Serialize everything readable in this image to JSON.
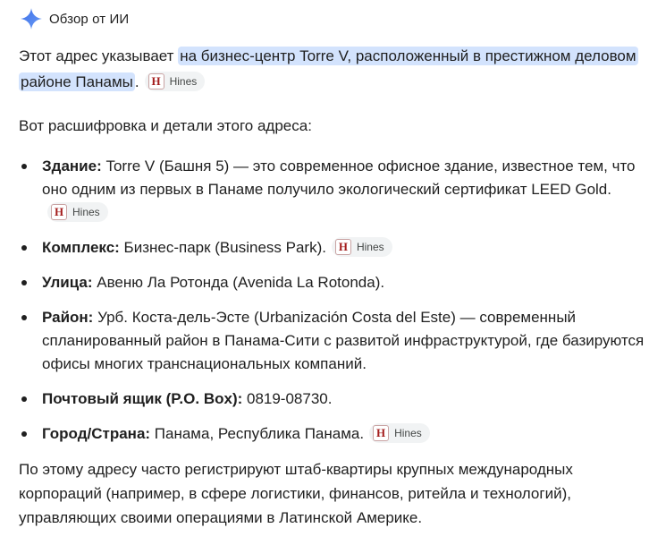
{
  "header": {
    "title": "Обзор от ИИ",
    "icon": "gemini-sparkle-icon",
    "icon_color": "#4a7bf0"
  },
  "intro": {
    "text_before": "Этот адрес указывает ",
    "highlight": "на бизнес-центр Torre V, расположенный в престижном деловом районе Панамы",
    "text_after": ".",
    "highlight_color": "#d3e3fd"
  },
  "source_label": "Hines",
  "subheading": "Вот расшифровка и детали этого адреса:",
  "details": [
    {
      "term": "Здание:",
      "text": " Torre V (Башня 5) — это современное офисное здание, известное тем, что оно одним из первых в Панаме получило экологический сертификат LEED Gold.",
      "source": "Hines"
    },
    {
      "term": "Комплекс:",
      "text": " Бизнес-парк (Business Park).",
      "source": "Hines"
    },
    {
      "term": "Улица:",
      "text": " Авеню Ла Ротонда (Avenida La Rotonda).",
      "source": ""
    },
    {
      "term": "Район:",
      "text": " Урб. Коста-дель-Эсте (Urbanización Costa del Este) — современный спланированный район в Панама-Сити с развитой инфраструктурой, где базируются офисы многих транснациональных компаний.",
      "source": ""
    },
    {
      "term": "Почтовый ящик (P.O. Box):",
      "text": " 0819-08730.",
      "source": ""
    },
    {
      "term": "Город/Страна:",
      "text": " Панама, Республика Панама.",
      "source": "Hines"
    }
  ],
  "outro": "По этому адресу часто регистрируют штаб-квартиры крупных международных корпораций (например, в сфере логистики, финансов, ритейла и технологий), управляющих своими операциями в Латинской Америке."
}
